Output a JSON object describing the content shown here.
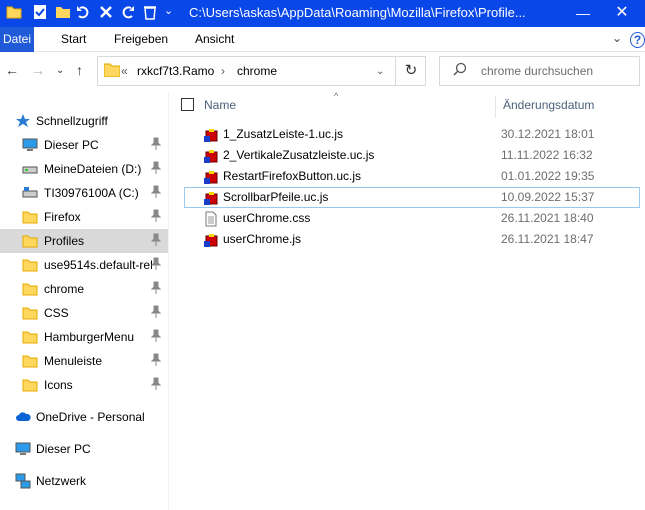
{
  "window": {
    "title": "C:\\Users\\askas\\AppData\\Roaming\\Mozilla\\Firefox\\Profile...",
    "accent": "#0a47e8"
  },
  "ribbon": {
    "tabs": [
      "Datei",
      "Start",
      "Freigeben",
      "Ansicht"
    ],
    "active_tab": "Datei"
  },
  "address": {
    "overflow": "«",
    "segments": [
      "rxkcf7t3.Ramo",
      "chrome"
    ]
  },
  "search": {
    "placeholder": "chrome durchsuchen"
  },
  "sidebar": {
    "items": [
      {
        "label": "Schnellzugriff",
        "icon": "star-icon",
        "pinned": false
      },
      {
        "label": "Dieser PC",
        "icon": "monitor-icon",
        "pinned": true
      },
      {
        "label": "MeineDateien (D:)",
        "icon": "drive-icon",
        "pinned": true
      },
      {
        "label": "TI30976100A (C:)",
        "icon": "system-drive-icon",
        "pinned": true
      },
      {
        "label": "Firefox",
        "icon": "folder-icon",
        "pinned": true
      },
      {
        "label": "Profiles",
        "icon": "folder-icon",
        "pinned": true
      },
      {
        "label": "use9514s.default-rel",
        "icon": "folder-icon",
        "pinned": true
      },
      {
        "label": "chrome",
        "icon": "folder-icon",
        "pinned": true
      },
      {
        "label": "CSS",
        "icon": "folder-icon",
        "pinned": true
      },
      {
        "label": "HamburgerMenu",
        "icon": "folder-icon",
        "pinned": true
      },
      {
        "label": "Menuleiste",
        "icon": "folder-icon",
        "pinned": true
      },
      {
        "label": "Icons",
        "icon": "folder-icon",
        "pinned": true
      },
      {
        "label": "OneDrive - Personal",
        "icon": "cloud-icon",
        "pinned": false
      },
      {
        "label": "Dieser PC",
        "icon": "monitor-icon",
        "pinned": false
      },
      {
        "label": "Netzwerk",
        "icon": "network-icon",
        "pinned": false
      }
    ],
    "selected": "Profiles"
  },
  "columns": {
    "name": "Name",
    "date": "Änderungsdatum"
  },
  "files": [
    {
      "name": "1_ZusatzLeiste-1.uc.js",
      "date": "30.12.2021 18:01",
      "icon": "js-file-icon"
    },
    {
      "name": "2_VertikaleZusatzleiste.uc.js",
      "date": "11.11.2022 16:32",
      "icon": "js-file-icon"
    },
    {
      "name": "RestartFirefoxButton.uc.js",
      "date": "01.01.2022 19:35",
      "icon": "js-file-icon"
    },
    {
      "name": "ScrollbarPfeile.uc.js",
      "date": "10.09.2022 15:37",
      "icon": "js-file-icon"
    },
    {
      "name": "userChrome.css",
      "date": "26.11.2021 18:40",
      "icon": "text-file-icon"
    },
    {
      "name": "userChrome.js",
      "date": "26.11.2021 18:47",
      "icon": "js-file-icon"
    }
  ]
}
